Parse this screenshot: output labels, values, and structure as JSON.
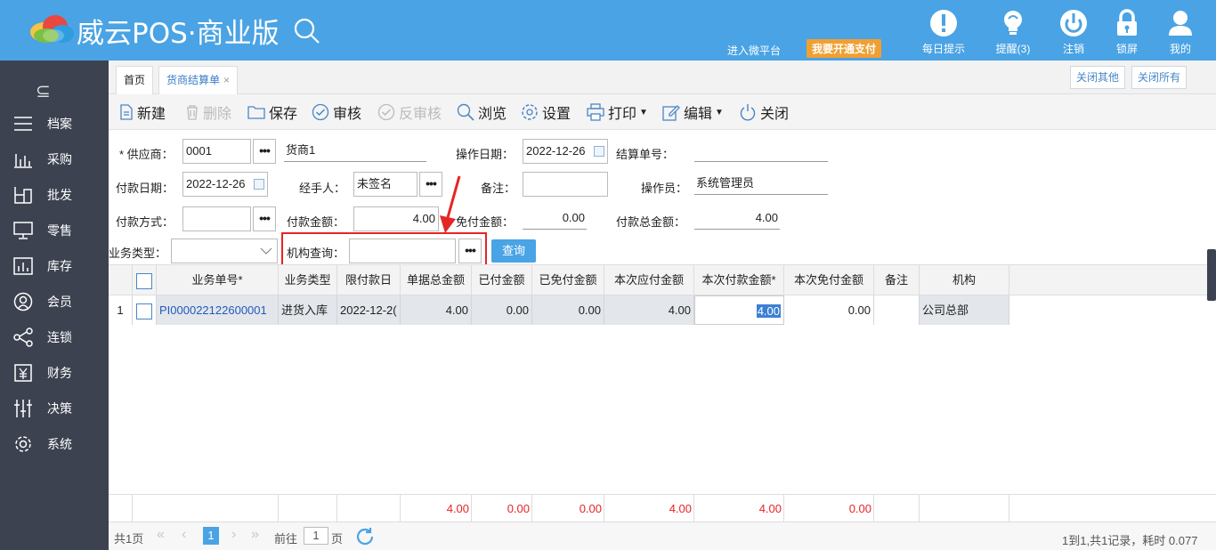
{
  "header": {
    "brand": "威云POS·商业版",
    "wechat_link": "进入微平台",
    "pay_button": "我要开通支付",
    "icons": [
      {
        "label": "每日提示",
        "icon": "exclamation-icon"
      },
      {
        "label": "提醒(3)",
        "icon": "bulb-icon"
      },
      {
        "label": "注销",
        "icon": "power-icon"
      },
      {
        "label": "锁屏",
        "icon": "lock-icon"
      },
      {
        "label": "我的",
        "icon": "user-icon"
      }
    ]
  },
  "sidebar": {
    "toggle": "⊆",
    "items": [
      {
        "label": "档案",
        "icon": "archive-icon"
      },
      {
        "label": "采购",
        "icon": "bar-chart-icon"
      },
      {
        "label": "批发",
        "icon": "wholesale-icon"
      },
      {
        "label": "零售",
        "icon": "monitor-icon"
      },
      {
        "label": "库存",
        "icon": "inventory-icon"
      },
      {
        "label": "会员",
        "icon": "member-icon"
      },
      {
        "label": "连锁",
        "icon": "share-icon"
      },
      {
        "label": "财务",
        "icon": "yuan-icon"
      },
      {
        "label": "决策",
        "icon": "sliders-icon"
      },
      {
        "label": "系统",
        "icon": "gear-icon"
      }
    ]
  },
  "tabs": {
    "home": "首页",
    "active": "货商结算单",
    "close_symbol": "×",
    "close_others": "关闭其他",
    "close_all": "关闭所有"
  },
  "toolbar": {
    "new": "新建",
    "delete": "删除",
    "save": "保存",
    "audit": "审核",
    "unaudit": "反审核",
    "browse": "浏览",
    "settings": "设置",
    "print": "打印",
    "edit": "编辑",
    "close": "关闭"
  },
  "form": {
    "supplier_label": "* 供应商：",
    "supplier_code": "0001",
    "supplier_name": "货商1",
    "op_date_label": "操作日期：",
    "op_date": "2022-12-26",
    "settle_no_label": "结算单号：",
    "settle_no": "",
    "pay_date_label": "付款日期：",
    "pay_date": "2022-12-26",
    "handler_label": "经手人：",
    "handler": "未签名",
    "remark_label": "备注：",
    "remark": "",
    "operator_label": "操作员：",
    "operator": "系统管理员",
    "pay_method_label": "付款方式：",
    "pay_method": "",
    "pay_amount_label": "付款金额：",
    "pay_amount": "4.00",
    "free_amount_label": "免付金额：",
    "free_amount": "0.00",
    "total_amount_label": "付款总金额：",
    "total_amount": "4.00",
    "biz_type_label": "业务类型：",
    "biz_type": "",
    "org_query_label": "机构查询：",
    "org_query": "",
    "query_button": "查询",
    "dots": "•••"
  },
  "table": {
    "headers": [
      "业务单号*",
      "业务类型",
      "限付款日",
      "单据总金额",
      "已付金额",
      "已免付金额",
      "本次应付金额",
      "本次付款金额*",
      "本次免付金额",
      "备注",
      "机构"
    ],
    "rows": [
      {
        "index": "1",
        "doc_no": "PI000022122600001",
        "type": "进货入库",
        "due_date": "2022-12-2(",
        "total": "4.00",
        "paid": "0.00",
        "free_paid": "0.00",
        "payable": "4.00",
        "pay_now": "4.00",
        "free_now": "0.00",
        "remark": "",
        "org": "公司总部"
      }
    ],
    "totals": {
      "total": "4.00",
      "paid": "0.00",
      "free_paid": "0.00",
      "payable": "4.00",
      "pay_now": "4.00",
      "free_now": "0.00"
    }
  },
  "pager": {
    "total_pages": "共1页",
    "current": "1",
    "goto_prefix": "前往",
    "goto_value": "1",
    "goto_suffix": "页",
    "summary": "1到1,共1记录，耗时 0.077"
  },
  "colors": {
    "header_bg": "#4aa3e4",
    "sidebar_bg": "#3c4250",
    "accent": "#4aa3e4",
    "highlight_red": "#e52525",
    "pay_badge": "#f0a033"
  }
}
